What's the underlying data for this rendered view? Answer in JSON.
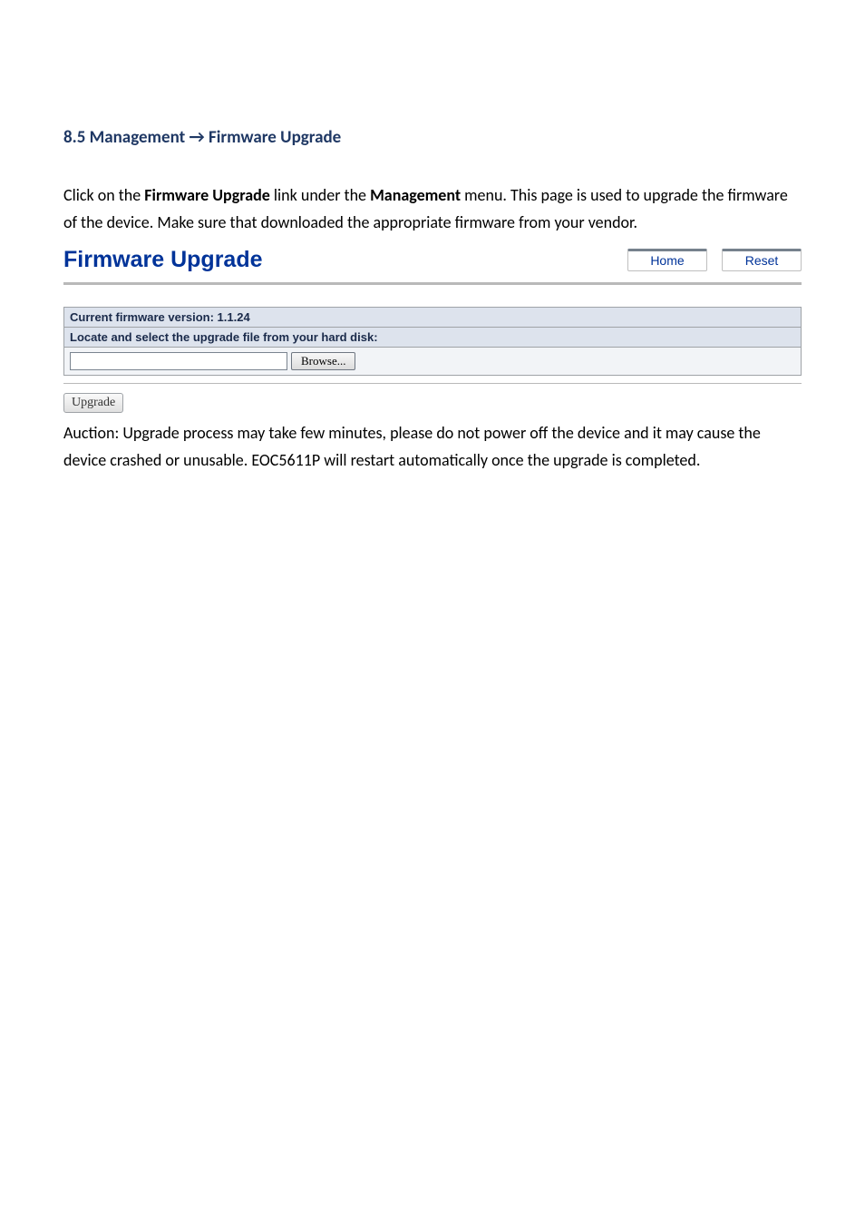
{
  "heading": "8.5 Management → Firmware Upgrade",
  "intro": {
    "pre1": "Click on the ",
    "bold1": "Firmware Upgrade",
    "mid1": " link under the ",
    "bold2": "Management",
    "post1": " menu. This page is used to upgrade the firmware of the device. Make sure that downloaded the appropriate firmware from your vendor."
  },
  "panel": {
    "title": "Firmware Upgrade",
    "home": "Home",
    "reset": "Reset",
    "version_label": "Current firmware version: 1.1.24",
    "locate_label": "Locate and select the upgrade file from your hard disk:",
    "browse_label": "Browse...",
    "upgrade_label": "Upgrade"
  },
  "footer": "Auction: Upgrade process may take few minutes, please do not power off the device and it may cause the device crashed or unusable. EOC5611P will restart automatically once the upgrade is completed."
}
